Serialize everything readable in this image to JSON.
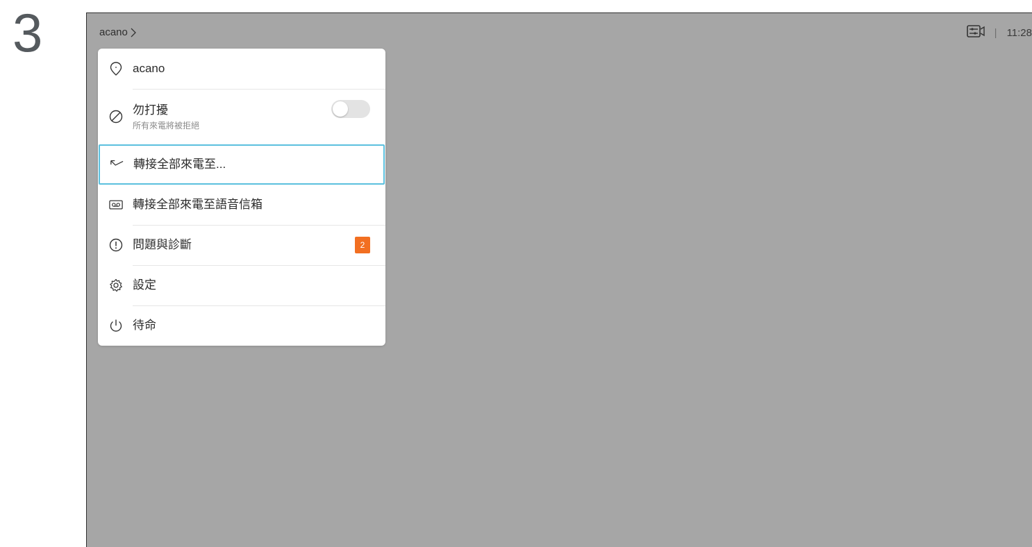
{
  "step_number": "3",
  "topbar": {
    "device_name": "acano",
    "time": "11:28",
    "separator": "|"
  },
  "menu": {
    "items": [
      {
        "label": "acano",
        "icon": "location-pin-icon"
      },
      {
        "label": "勿打擾",
        "sublabel": "所有來電將被拒絕",
        "icon": "do-not-disturb-icon",
        "toggle": false
      },
      {
        "label": "轉接全部來電至...",
        "icon": "forward-call-icon",
        "focused": true
      },
      {
        "label": "轉接全部來電至語音信箱",
        "icon": "voicemail-icon"
      },
      {
        "label": "問題與診斷",
        "icon": "alert-icon",
        "badge": "2"
      },
      {
        "label": "設定",
        "icon": "gear-icon"
      },
      {
        "label": "待命",
        "icon": "standby-icon"
      }
    ]
  },
  "colors": {
    "background": "#a6a6a6",
    "panel": "#ffffff",
    "focus_ring": "#5bc0de",
    "badge": "#f26f21"
  }
}
